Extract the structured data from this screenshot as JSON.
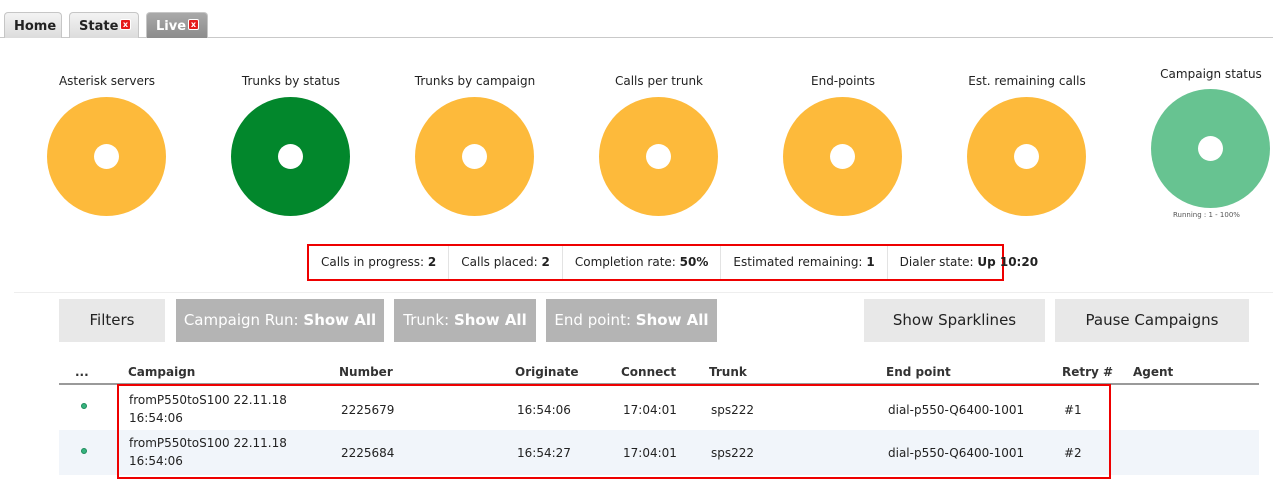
{
  "tabs": [
    {
      "label": "Home"
    },
    {
      "label": "State",
      "close": "x"
    },
    {
      "label": "Live",
      "close": "x"
    }
  ],
  "gauges": [
    {
      "title": "Asterisk servers",
      "color": "#FDBA3B"
    },
    {
      "title": "Trunks by status",
      "color": "#02872C"
    },
    {
      "title": "Trunks by campaign",
      "color": "#FDBA3B"
    },
    {
      "title": "Calls per trunk",
      "color": "#FDBA3B"
    },
    {
      "title": "End-points",
      "color": "#FDBA3B"
    },
    {
      "title": "Est. remaining calls",
      "color": "#FDBA3B"
    },
    {
      "title": "Campaign status",
      "color": "#67C391",
      "caption": "Running : 1 - 100%"
    }
  ],
  "summary": [
    {
      "label": "Calls in progress:",
      "value": "2"
    },
    {
      "label": "Calls placed:",
      "value": "2"
    },
    {
      "label": "Completion rate:",
      "value": "50%"
    },
    {
      "label": "Estimated remaining:",
      "value": "1"
    },
    {
      "label": "Dialer state:",
      "value": "Up 10:20"
    }
  ],
  "buttons": {
    "filters": "Filters",
    "campaign_run": {
      "label": "Campaign Run:",
      "value": "Show All"
    },
    "trunk": {
      "label": "Trunk:",
      "value": "Show All"
    },
    "end_point": {
      "label": "End point:",
      "value": "Show All"
    },
    "show_sparklines": "Show Sparklines",
    "pause_campaigns": "Pause Campaigns"
  },
  "table": {
    "columns": [
      "...",
      "Campaign",
      "Number",
      "Originate",
      "Connect",
      "Trunk",
      "End point",
      "Retry #",
      "Agent"
    ],
    "rows": [
      {
        "campaign_line1": "fromP550toS100 22.11.18",
        "campaign_line2": "16:54:06",
        "number": "2225679",
        "originate": "16:54:06",
        "connect": "17:04:01",
        "trunk": "sps222",
        "end_point": "dial-p550-Q6400-1001",
        "retry": "#1",
        "agent": ""
      },
      {
        "campaign_line1": "fromP550toS100 22.11.18",
        "campaign_line2": "16:54:06",
        "number": "2225684",
        "originate": "16:54:27",
        "connect": "17:04:01",
        "trunk": "sps222",
        "end_point": "dial-p550-Q6400-1001",
        "retry": "#2",
        "agent": ""
      }
    ]
  }
}
